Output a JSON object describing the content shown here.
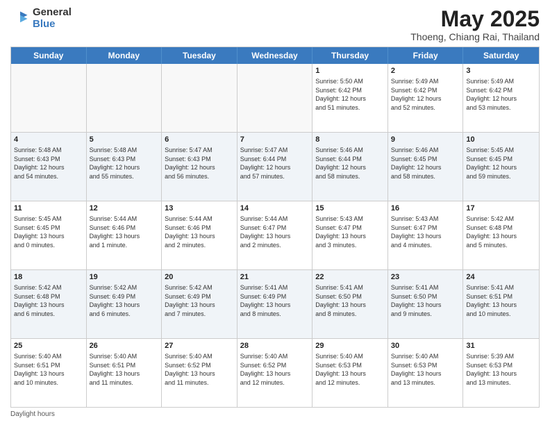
{
  "header": {
    "logo_general": "General",
    "logo_blue": "Blue",
    "month_title": "May 2025",
    "subtitle": "Thoeng, Chiang Rai, Thailand"
  },
  "days_of_week": [
    "Sunday",
    "Monday",
    "Tuesday",
    "Wednesday",
    "Thursday",
    "Friday",
    "Saturday"
  ],
  "rows": [
    [
      {
        "day": "",
        "info": ""
      },
      {
        "day": "",
        "info": ""
      },
      {
        "day": "",
        "info": ""
      },
      {
        "day": "",
        "info": ""
      },
      {
        "day": "1",
        "info": "Sunrise: 5:50 AM\nSunset: 6:42 PM\nDaylight: 12 hours\nand 51 minutes."
      },
      {
        "day": "2",
        "info": "Sunrise: 5:49 AM\nSunset: 6:42 PM\nDaylight: 12 hours\nand 52 minutes."
      },
      {
        "day": "3",
        "info": "Sunrise: 5:49 AM\nSunset: 6:42 PM\nDaylight: 12 hours\nand 53 minutes."
      }
    ],
    [
      {
        "day": "4",
        "info": "Sunrise: 5:48 AM\nSunset: 6:43 PM\nDaylight: 12 hours\nand 54 minutes."
      },
      {
        "day": "5",
        "info": "Sunrise: 5:48 AM\nSunset: 6:43 PM\nDaylight: 12 hours\nand 55 minutes."
      },
      {
        "day": "6",
        "info": "Sunrise: 5:47 AM\nSunset: 6:43 PM\nDaylight: 12 hours\nand 56 minutes."
      },
      {
        "day": "7",
        "info": "Sunrise: 5:47 AM\nSunset: 6:44 PM\nDaylight: 12 hours\nand 57 minutes."
      },
      {
        "day": "8",
        "info": "Sunrise: 5:46 AM\nSunset: 6:44 PM\nDaylight: 12 hours\nand 58 minutes."
      },
      {
        "day": "9",
        "info": "Sunrise: 5:46 AM\nSunset: 6:45 PM\nDaylight: 12 hours\nand 58 minutes."
      },
      {
        "day": "10",
        "info": "Sunrise: 5:45 AM\nSunset: 6:45 PM\nDaylight: 12 hours\nand 59 minutes."
      }
    ],
    [
      {
        "day": "11",
        "info": "Sunrise: 5:45 AM\nSunset: 6:45 PM\nDaylight: 13 hours\nand 0 minutes."
      },
      {
        "day": "12",
        "info": "Sunrise: 5:44 AM\nSunset: 6:46 PM\nDaylight: 13 hours\nand 1 minute."
      },
      {
        "day": "13",
        "info": "Sunrise: 5:44 AM\nSunset: 6:46 PM\nDaylight: 13 hours\nand 2 minutes."
      },
      {
        "day": "14",
        "info": "Sunrise: 5:44 AM\nSunset: 6:47 PM\nDaylight: 13 hours\nand 2 minutes."
      },
      {
        "day": "15",
        "info": "Sunrise: 5:43 AM\nSunset: 6:47 PM\nDaylight: 13 hours\nand 3 minutes."
      },
      {
        "day": "16",
        "info": "Sunrise: 5:43 AM\nSunset: 6:47 PM\nDaylight: 13 hours\nand 4 minutes."
      },
      {
        "day": "17",
        "info": "Sunrise: 5:42 AM\nSunset: 6:48 PM\nDaylight: 13 hours\nand 5 minutes."
      }
    ],
    [
      {
        "day": "18",
        "info": "Sunrise: 5:42 AM\nSunset: 6:48 PM\nDaylight: 13 hours\nand 6 minutes."
      },
      {
        "day": "19",
        "info": "Sunrise: 5:42 AM\nSunset: 6:49 PM\nDaylight: 13 hours\nand 6 minutes."
      },
      {
        "day": "20",
        "info": "Sunrise: 5:42 AM\nSunset: 6:49 PM\nDaylight: 13 hours\nand 7 minutes."
      },
      {
        "day": "21",
        "info": "Sunrise: 5:41 AM\nSunset: 6:49 PM\nDaylight: 13 hours\nand 8 minutes."
      },
      {
        "day": "22",
        "info": "Sunrise: 5:41 AM\nSunset: 6:50 PM\nDaylight: 13 hours\nand 8 minutes."
      },
      {
        "day": "23",
        "info": "Sunrise: 5:41 AM\nSunset: 6:50 PM\nDaylight: 13 hours\nand 9 minutes."
      },
      {
        "day": "24",
        "info": "Sunrise: 5:41 AM\nSunset: 6:51 PM\nDaylight: 13 hours\nand 10 minutes."
      }
    ],
    [
      {
        "day": "25",
        "info": "Sunrise: 5:40 AM\nSunset: 6:51 PM\nDaylight: 13 hours\nand 10 minutes."
      },
      {
        "day": "26",
        "info": "Sunrise: 5:40 AM\nSunset: 6:51 PM\nDaylight: 13 hours\nand 11 minutes."
      },
      {
        "day": "27",
        "info": "Sunrise: 5:40 AM\nSunset: 6:52 PM\nDaylight: 13 hours\nand 11 minutes."
      },
      {
        "day": "28",
        "info": "Sunrise: 5:40 AM\nSunset: 6:52 PM\nDaylight: 13 hours\nand 12 minutes."
      },
      {
        "day": "29",
        "info": "Sunrise: 5:40 AM\nSunset: 6:53 PM\nDaylight: 13 hours\nand 12 minutes."
      },
      {
        "day": "30",
        "info": "Sunrise: 5:40 AM\nSunset: 6:53 PM\nDaylight: 13 hours\nand 13 minutes."
      },
      {
        "day": "31",
        "info": "Sunrise: 5:39 AM\nSunset: 6:53 PM\nDaylight: 13 hours\nand 13 minutes."
      }
    ]
  ],
  "footer": {
    "note": "Daylight hours"
  },
  "colors": {
    "header_bg": "#3a7abf",
    "alt_row_bg": "#e8f0f8",
    "white": "#ffffff"
  }
}
